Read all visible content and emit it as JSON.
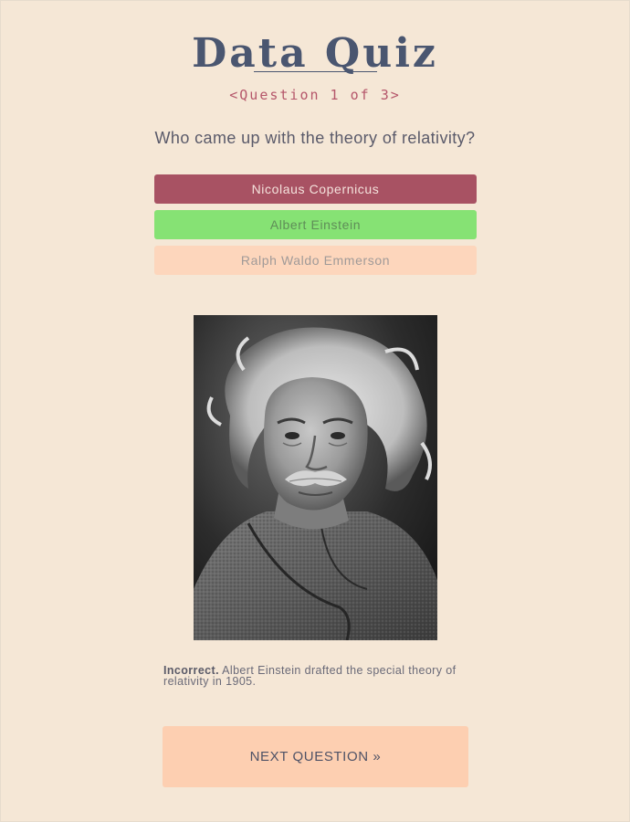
{
  "quiz": {
    "title": "Data Quiz",
    "progress": "<Question 1 of 3>",
    "question": "Who came up with the theory of relativity?",
    "answers": [
      {
        "label": "Nicolaus Copernicus",
        "state": "wrong"
      },
      {
        "label": "Albert Einstein",
        "state": "correct"
      },
      {
        "label": "Ralph Waldo Emmerson",
        "state": "neutral"
      }
    ],
    "image": "black-and-white portrait",
    "feedback": {
      "verdict": "Incorrect.",
      "message": "Albert Einstein drafted the special theory of relativity in 1905."
    },
    "next_label": "NEXT QUESTION »"
  },
  "colors": {
    "background": "#f5e7d6",
    "title": "#4a5670",
    "progress": "#b5566a",
    "wrong": "#a85263",
    "correct": "#86e274",
    "neutral": "#fdd6bc",
    "next_button": "#fdcfb1"
  }
}
